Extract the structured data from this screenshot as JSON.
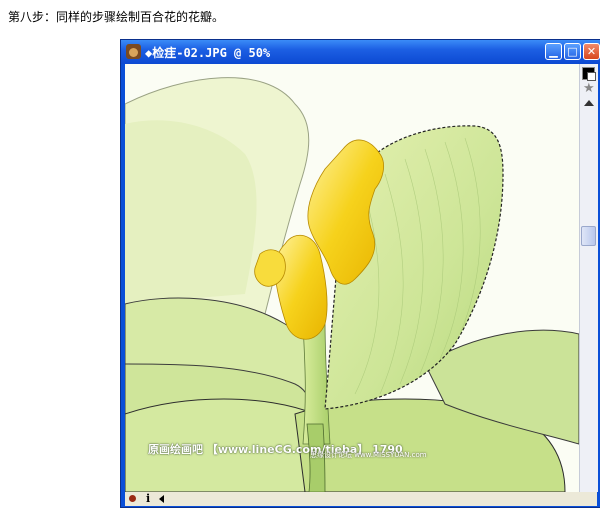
{
  "caption": "第八步：同样的步骤绘制百合花的花瓣。",
  "window": {
    "title": "◆检疰-02.JPG @ 50%",
    "icon": "photoshop-app-icon",
    "buttons": {
      "minimize": "▁",
      "maximize": "□",
      "close": "✕"
    }
  },
  "watermark": {
    "line1": "原画绘画吧 【www.lineCG.com/tieba】 1790",
    "line2": "思缘设计论坛 www.MISSYUAN.com"
  },
  "colors": {
    "titlebar": "#0c49d2",
    "petal_green": "#c8e08a",
    "stamen_yellow": "#f4d21c"
  }
}
